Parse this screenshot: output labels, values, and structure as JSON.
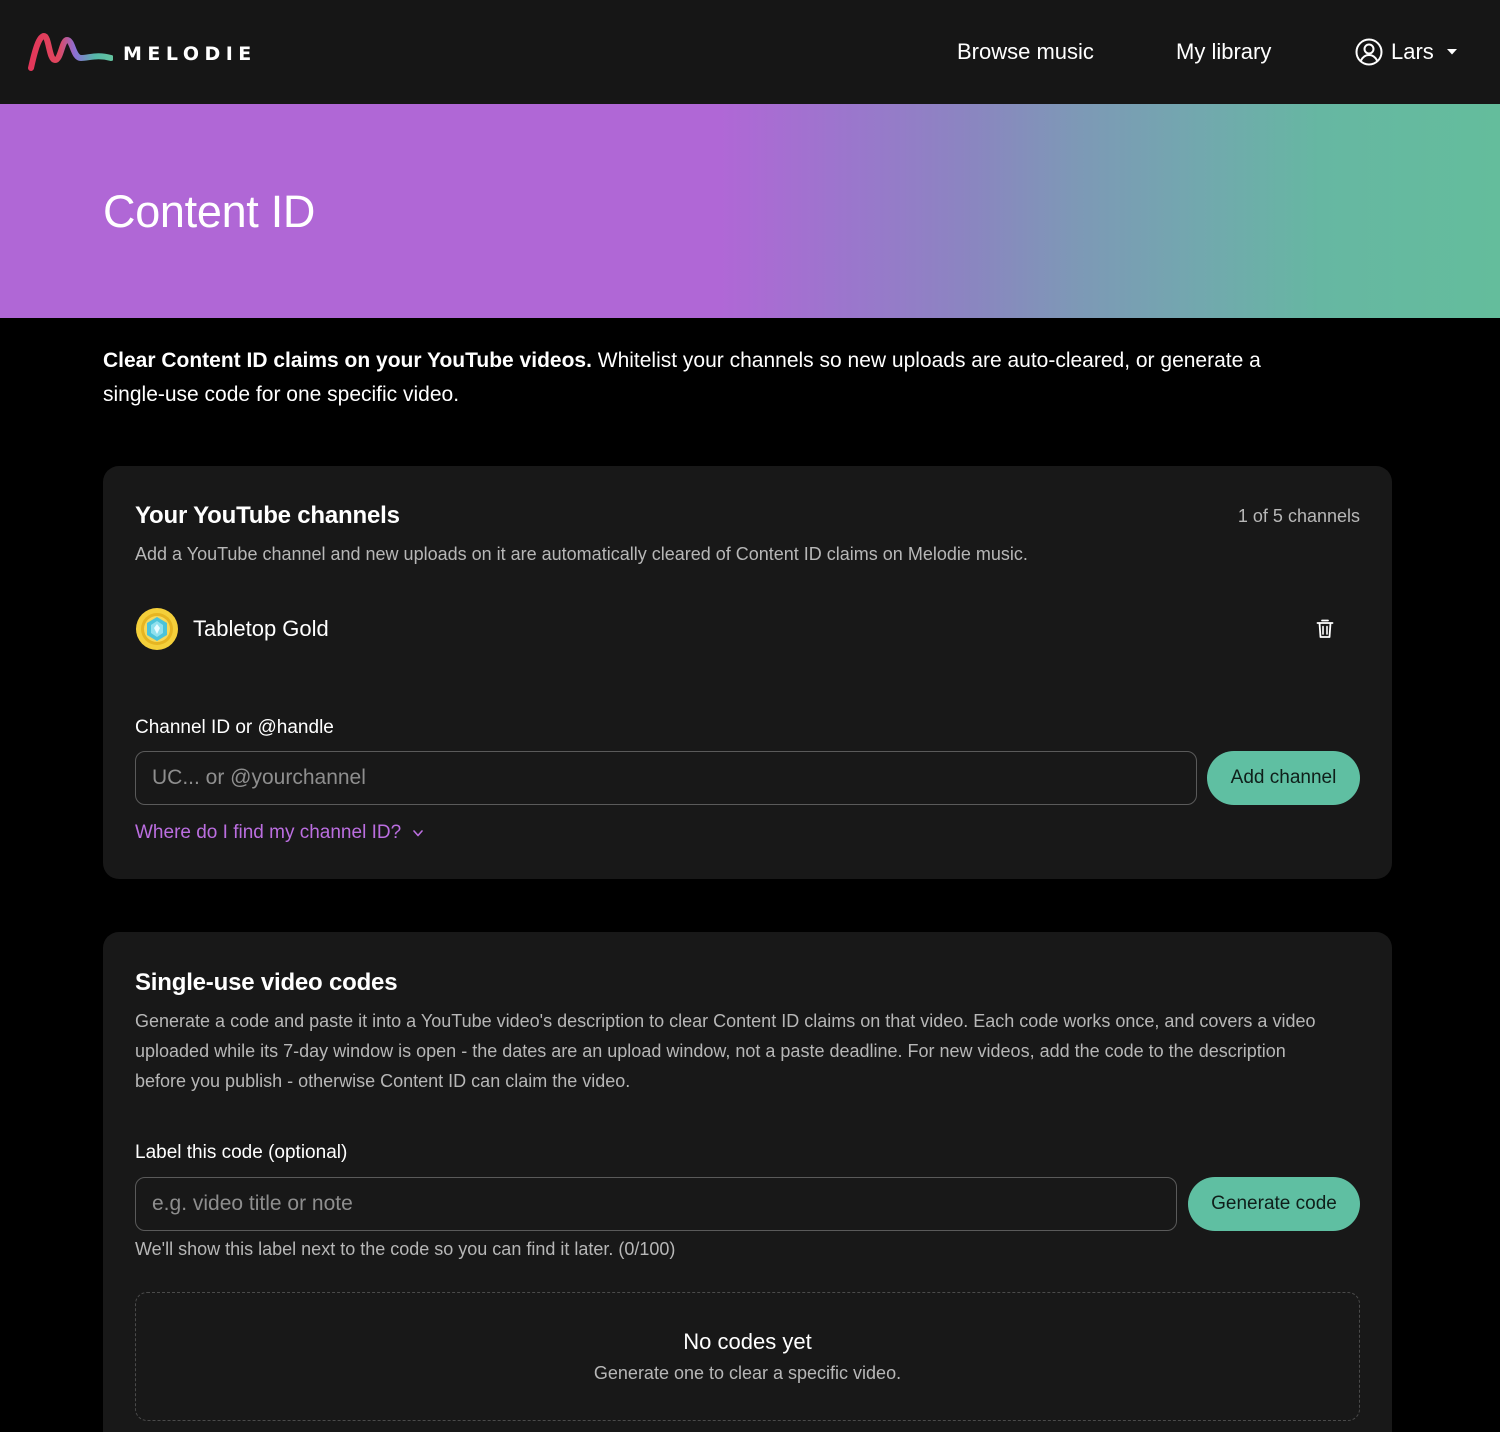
{
  "nav": {
    "brand": "MELODIE",
    "links": {
      "browse": "Browse music",
      "library": "My library"
    },
    "user": "Lars"
  },
  "hero": {
    "title": "Content ID"
  },
  "intro": {
    "strong": "Clear Content ID claims on your YouTube videos.",
    "text": " Whitelist your channels so new uploads are auto-cleared, or generate a single-use code for one specific video."
  },
  "channels": {
    "title": "Your YouTube channels",
    "count": "1 of 5 channels",
    "description": "Add a YouTube channel and new uploads on it are automatically cleared of Content ID claims on Melodie music.",
    "items": [
      {
        "name": "Tabletop Gold",
        "avatar_icon": "tabletop-gold-avatar-icon"
      }
    ],
    "input_label": "Channel ID or @handle",
    "input_placeholder": "UC... or @yourchannel",
    "input_value": "",
    "add_button": "Add channel",
    "help_link": "Where do I find my channel ID?"
  },
  "codes": {
    "title": "Single-use video codes",
    "description": "Generate a code and paste it into a YouTube video's description to clear Content ID claims on that video. Each code works once, and covers a video uploaded while its 7-day window is open - the dates are an upload window, not a paste deadline. For new videos, add the code to the description before you publish - otherwise Content ID can claim the video.",
    "input_label": "Label this code (optional)",
    "input_placeholder": "e.g. video title or note",
    "input_value": "",
    "generate_button": "Generate code",
    "hint": "We'll show this label next to the code so you can find it later. (0/100)",
    "empty_title": "No codes yet",
    "empty_subtitle": "Generate one to clear a specific video."
  },
  "colors": {
    "page_bg": "#000000",
    "nav_bg": "#161616",
    "card_bg": "#181818",
    "accent_green": "#5fbfa2",
    "link_purple": "#bb6ee0",
    "hero_gradient_start": "#b067d6",
    "hero_gradient_end": "#64bd9c"
  }
}
